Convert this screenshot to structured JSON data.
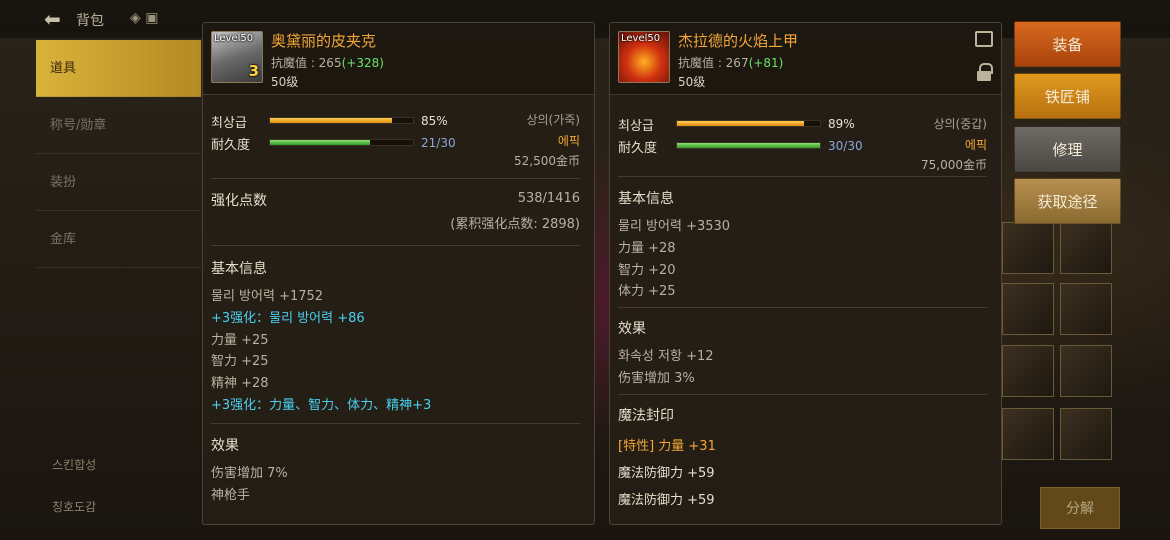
{
  "topbar": {
    "title": "背包"
  },
  "leftnav": {
    "items": [
      "道具",
      "称号/勋章",
      "装扮",
      "金库"
    ],
    "bottom": [
      "스킨합성",
      "칭호도감"
    ]
  },
  "bottom_buttons": [
    "分解"
  ],
  "actions": {
    "equip": "装备",
    "smith": "铁匠铺",
    "repair": "修理",
    "source": "获取途径"
  },
  "left_item": {
    "icon_level": "Level50",
    "icon_plus": "3",
    "name": "奥黛丽的皮夹克",
    "magic_resist_label": "抗魔值 : 265",
    "magic_resist_bonus": "(+328)",
    "level": "50级",
    "max_grade_label": "최상급",
    "max_grade_pct": "85%",
    "max_grade_value": 0.85,
    "durability_label": "耐久度",
    "durability_text": "21/30",
    "durability_value": 0.7,
    "type": "상의(가죽)",
    "rarity": "에픽",
    "price": "52,500金币",
    "enh_points_label": "强化点数",
    "enh_points": "538/1416",
    "enh_total": "(累积强化点数: 2898)",
    "basic_title": "基本信息",
    "basic_lines": [
      {
        "text": "물리 방어력 +1752",
        "style": "plain"
      },
      {
        "text": "+3强化：물리 방어력 +86",
        "style": "cyan"
      },
      {
        "text": "力量 +25",
        "style": "plain"
      },
      {
        "text": "智力 +25",
        "style": "plain"
      },
      {
        "text": "精神 +28",
        "style": "plain"
      },
      {
        "text": "+3强化：力量、智力、体力、精神+3",
        "style": "cyan"
      }
    ],
    "effect_title": "效果",
    "effect_lines": [
      "伤害增加 7%",
      "神枪手"
    ]
  },
  "right_item": {
    "icon_level": "Level50",
    "name": "杰拉德的火焰上甲",
    "magic_resist_label": "抗魔值 : 267",
    "magic_resist_bonus": "(+81)",
    "level": "50级",
    "max_grade_label": "최상급",
    "max_grade_pct": "89%",
    "max_grade_value": 0.89,
    "durability_label": "耐久度",
    "durability_text": "30/30",
    "durability_value": 1.0,
    "type": "상의(중갑)",
    "rarity": "에픽",
    "price": "75,000金币",
    "basic_title": "基本信息",
    "basic_lines": [
      "물리 방어력 +3530",
      "力量 +28",
      "智力 +20",
      "体力 +25"
    ],
    "effect_title": "效果",
    "effect_lines": [
      "화속성 저항 +12",
      "伤害增加 3%"
    ],
    "seal_title": "魔法封印",
    "seal_lines": [
      {
        "text": "[特性] 力量 +31",
        "style": "orange"
      },
      {
        "text": "魔法防御力 +59",
        "style": "white"
      },
      {
        "text": "魔法防御力 +59",
        "style": "white"
      }
    ]
  }
}
